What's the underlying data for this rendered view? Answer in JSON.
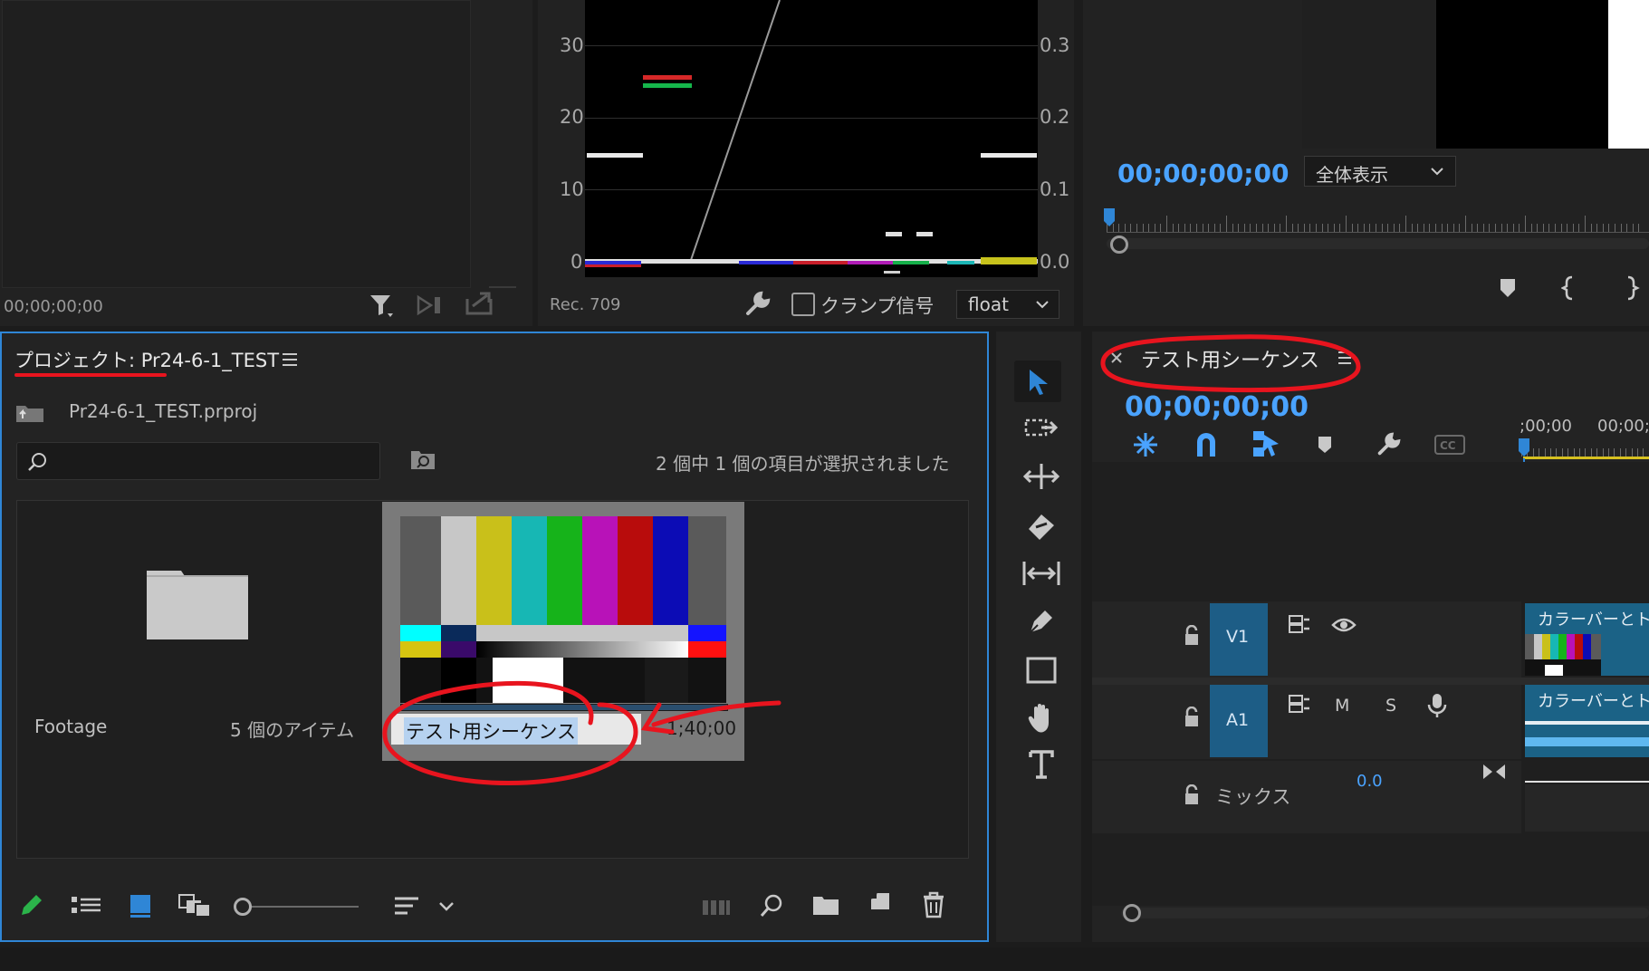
{
  "source_monitor": {
    "timecode": "00;00;00;00"
  },
  "scopes": {
    "left_labels": [
      "30",
      "20",
      "10",
      "0"
    ],
    "right_labels": [
      "0.3",
      "0.2",
      "0.1",
      "0.0"
    ],
    "colorspace": "Rec. 709",
    "clamp_label": "クランプ信号",
    "mode": "float"
  },
  "program_monitor": {
    "timecode": "00;00;00;00",
    "zoom": "全体表示"
  },
  "project": {
    "title_prefix": "プロジェクト: ",
    "title_name": "Pr24-6-1_TEST",
    "file": "Pr24-6-1_TEST.prproj",
    "search_placeholder": "",
    "selection_status": "2 個中 1 個の項目が選択されました",
    "folder": {
      "name": "Footage",
      "count": "5 個のアイテム"
    },
    "sequence": {
      "name": "テスト用シーケンス",
      "duration": "1;40;00"
    }
  },
  "timeline": {
    "tab": "テスト用シーケンス",
    "timecode": "00;00;00;00",
    "ruler_labels": [
      ";00;00",
      "00;00;"
    ],
    "tracks": [
      {
        "id": "V1",
        "clip": "カラーバーとト"
      },
      {
        "id": "A1",
        "m": "M",
        "s": "S",
        "clip": "カラーバーとト"
      }
    ],
    "mix_label": "ミックス",
    "mix_value": "0.0"
  },
  "colors": {
    "accent": "#4aa3ff",
    "annotation": "#e8141e",
    "panel_border": "#2f86d6",
    "track_blue": "#1d5d86"
  }
}
